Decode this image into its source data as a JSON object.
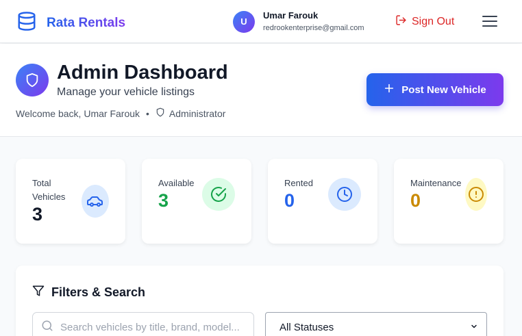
{
  "nav": {
    "brand": "Rata Rentals",
    "user_initial": "U",
    "user_name": "Umar Farouk",
    "user_email": "redrookenterprise@gmail.com",
    "signout_label": "Sign Out"
  },
  "header": {
    "title": "Admin Dashboard",
    "subtitle": "Manage your vehicle listings",
    "welcome": "Welcome back, Umar Farouk",
    "separator": "•",
    "role": "Administrator",
    "post_button": "Post New Vehicle"
  },
  "stats": [
    {
      "label": "Total Vehicles",
      "value": "3",
      "icon": "car-icon",
      "color": "#111827"
    },
    {
      "label": "Available",
      "value": "3",
      "icon": "check-circle-icon",
      "color": "#16a34a"
    },
    {
      "label": "Rented",
      "value": "0",
      "icon": "clock-icon",
      "color": "#2563eb"
    },
    {
      "label": "Maintenance",
      "value": "0",
      "icon": "alert-circle-icon",
      "color": "#ca8a04"
    }
  ],
  "filters": {
    "title": "Filters & Search",
    "search_placeholder": "Search vehicles by title, brand, model...",
    "status_value": "All Statuses"
  },
  "colors": {
    "accent_start": "#2563eb",
    "accent_end": "#7c3aed",
    "danger": "#dc2626"
  }
}
